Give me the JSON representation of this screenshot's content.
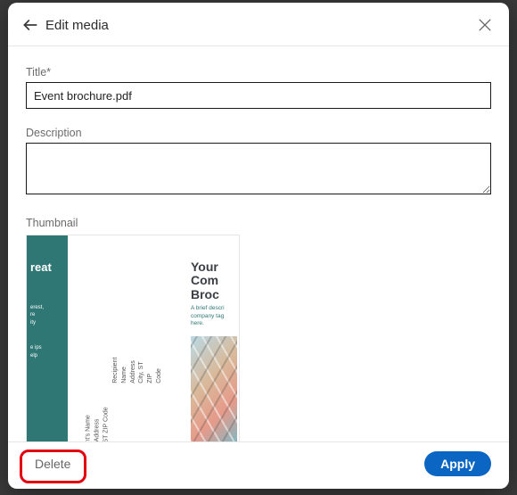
{
  "header": {
    "title": "Edit media"
  },
  "form": {
    "title_label": "Title*",
    "title_value": "Event brochure.pdf",
    "description_label": "Description",
    "description_value": "",
    "thumbnail_label": "Thumbnail"
  },
  "brochure": {
    "left_heading": "reat",
    "left_lines_a": "erest,\nre\nity",
    "left_lines_b": "e ips\nelp",
    "rot1": "ent's Name\ns Address\n, ST  ZIP Code",
    "rot2": "Recipient Name\nAddress\nCity, ST  ZIP Code",
    "right_h1": "Your\nCom\nBroc",
    "right_sub": "A brief descri\ncompany tag\nhere."
  },
  "footer": {
    "delete": "Delete",
    "apply": "Apply"
  }
}
